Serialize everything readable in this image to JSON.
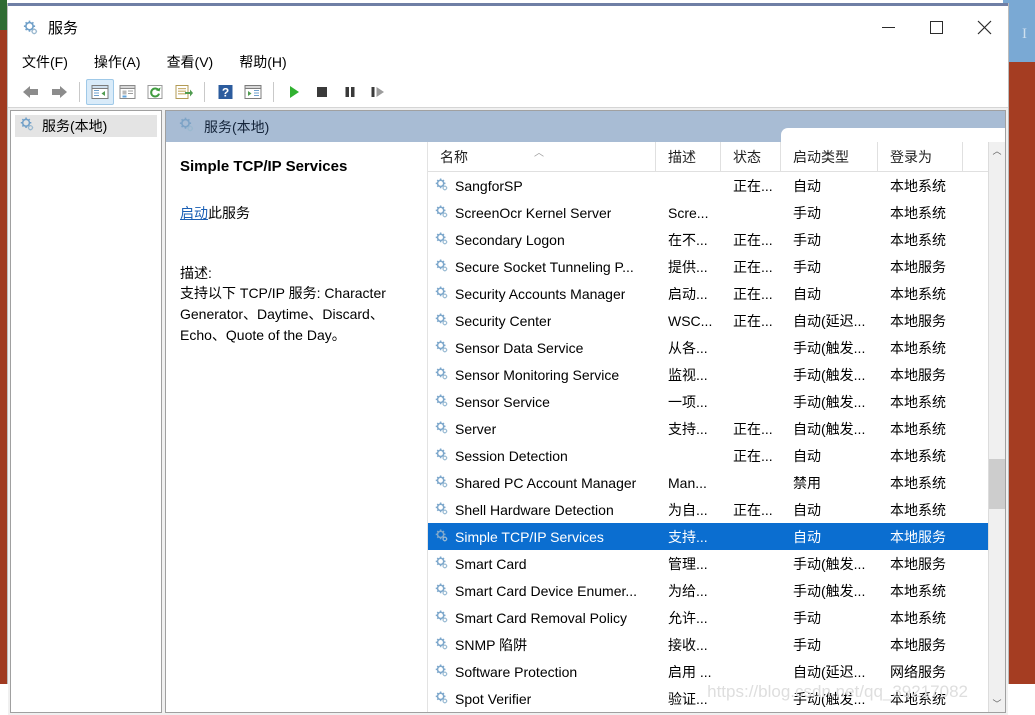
{
  "window": {
    "title": "服务",
    "icon": "services-gear-icon",
    "controls": {
      "minimize": "最小化",
      "maximize": "最大化",
      "close": "关闭"
    }
  },
  "menubar": {
    "items": [
      {
        "label": "文件(F)",
        "name": "menu-file"
      },
      {
        "label": "操作(A)",
        "name": "menu-action"
      },
      {
        "label": "查看(V)",
        "name": "menu-view"
      },
      {
        "label": "帮助(H)",
        "name": "menu-help"
      }
    ]
  },
  "toolbar": {
    "buttons": [
      {
        "name": "back-arrow-icon",
        "title": "后退"
      },
      {
        "name": "forward-arrow-icon",
        "title": "前进"
      },
      {
        "name": "show-hide-tree-icon",
        "title": "显示/隐藏控制台树"
      },
      {
        "name": "properties-icon",
        "title": "属性"
      },
      {
        "name": "refresh-icon",
        "title": "刷新"
      },
      {
        "name": "export-list-icon",
        "title": "导出列表"
      },
      {
        "name": "help-icon",
        "title": "帮助"
      },
      {
        "name": "show-action-pane-icon",
        "title": "显示操作窗格"
      },
      {
        "name": "start-service-icon",
        "title": "启动服务"
      },
      {
        "name": "stop-service-icon",
        "title": "停止服务"
      },
      {
        "name": "pause-service-icon",
        "title": "暂停服务"
      },
      {
        "name": "restart-service-icon",
        "title": "重启服务"
      }
    ]
  },
  "tree": {
    "nodes": [
      {
        "label": "服务(本地)",
        "selected": true
      }
    ]
  },
  "pane": {
    "header_label": "服务(本地)",
    "header_icon": "services-gear-icon"
  },
  "detail": {
    "service_title": "Simple TCP/IP Services",
    "action_link": "启动",
    "action_suffix": "此服务",
    "description_label": "描述:",
    "description_body": "支持以下 TCP/IP 服务: Character Generator、Daytime、Discard、Echo、Quote of the Day。"
  },
  "list": {
    "sort_indicator": "︿",
    "columns": [
      {
        "label": "名称",
        "key": "name"
      },
      {
        "label": "描述",
        "key": "desc"
      },
      {
        "label": "状态",
        "key": "state"
      },
      {
        "label": "启动类型",
        "key": "start"
      },
      {
        "label": "登录为",
        "key": "logon"
      }
    ],
    "rows": [
      {
        "name": "SangforSP",
        "desc": "",
        "state": "正在...",
        "start": "自动",
        "logon": "本地系统",
        "selected": false
      },
      {
        "name": "ScreenOcr Kernel Server",
        "desc": "Scre...",
        "state": "",
        "start": "手动",
        "logon": "本地系统",
        "selected": false
      },
      {
        "name": "Secondary Logon",
        "desc": "在不...",
        "state": "正在...",
        "start": "手动",
        "logon": "本地系统",
        "selected": false
      },
      {
        "name": "Secure Socket Tunneling P...",
        "desc": "提供...",
        "state": "正在...",
        "start": "手动",
        "logon": "本地服务",
        "selected": false
      },
      {
        "name": "Security Accounts Manager",
        "desc": "启动...",
        "state": "正在...",
        "start": "自动",
        "logon": "本地系统",
        "selected": false
      },
      {
        "name": "Security Center",
        "desc": "WSC...",
        "state": "正在...",
        "start": "自动(延迟...",
        "logon": "本地服务",
        "selected": false
      },
      {
        "name": "Sensor Data Service",
        "desc": "从各...",
        "state": "",
        "start": "手动(触发...",
        "logon": "本地系统",
        "selected": false
      },
      {
        "name": "Sensor Monitoring Service",
        "desc": "监视...",
        "state": "",
        "start": "手动(触发...",
        "logon": "本地服务",
        "selected": false
      },
      {
        "name": "Sensor Service",
        "desc": "一项...",
        "state": "",
        "start": "手动(触发...",
        "logon": "本地系统",
        "selected": false
      },
      {
        "name": "Server",
        "desc": "支持...",
        "state": "正在...",
        "start": "自动(触发...",
        "logon": "本地系统",
        "selected": false
      },
      {
        "name": "Session Detection",
        "desc": "",
        "state": "正在...",
        "start": "自动",
        "logon": "本地系统",
        "selected": false
      },
      {
        "name": "Shared PC Account Manager",
        "desc": "Man...",
        "state": "",
        "start": "禁用",
        "logon": "本地系统",
        "selected": false
      },
      {
        "name": "Shell Hardware Detection",
        "desc": "为自...",
        "state": "正在...",
        "start": "自动",
        "logon": "本地系统",
        "selected": false
      },
      {
        "name": "Simple TCP/IP Services",
        "desc": "支持...",
        "state": "",
        "start": "自动",
        "logon": "本地服务",
        "selected": true
      },
      {
        "name": "Smart Card",
        "desc": "管理...",
        "state": "",
        "start": "手动(触发...",
        "logon": "本地服务",
        "selected": false
      },
      {
        "name": "Smart Card Device Enumer...",
        "desc": "为给...",
        "state": "",
        "start": "手动(触发...",
        "logon": "本地系统",
        "selected": false
      },
      {
        "name": "Smart Card Removal Policy",
        "desc": "允许...",
        "state": "",
        "start": "手动",
        "logon": "本地系统",
        "selected": false
      },
      {
        "name": "SNMP 陷阱",
        "desc": "接收...",
        "state": "",
        "start": "手动",
        "logon": "本地服务",
        "selected": false
      },
      {
        "name": "Software Protection",
        "desc": "启用 ...",
        "state": "",
        "start": "自动(延迟...",
        "logon": "网络服务",
        "selected": false
      },
      {
        "name": "Spot Verifier",
        "desc": "验证...",
        "state": "",
        "start": "手动(触发...",
        "logon": "本地系统",
        "selected": false
      }
    ],
    "scrollbar": {
      "up_arrow": "︿",
      "down_arrow": "﹀"
    }
  },
  "watermark": {
    "text": "https://blog.csdn.net/qq_39217082"
  },
  "colors": {
    "selection_blue": "#0b6ed0",
    "pane_header_blue": "#a8bcd4",
    "link_blue": "#1a5fb4",
    "titlebar_accent": "#6f7fa5"
  }
}
